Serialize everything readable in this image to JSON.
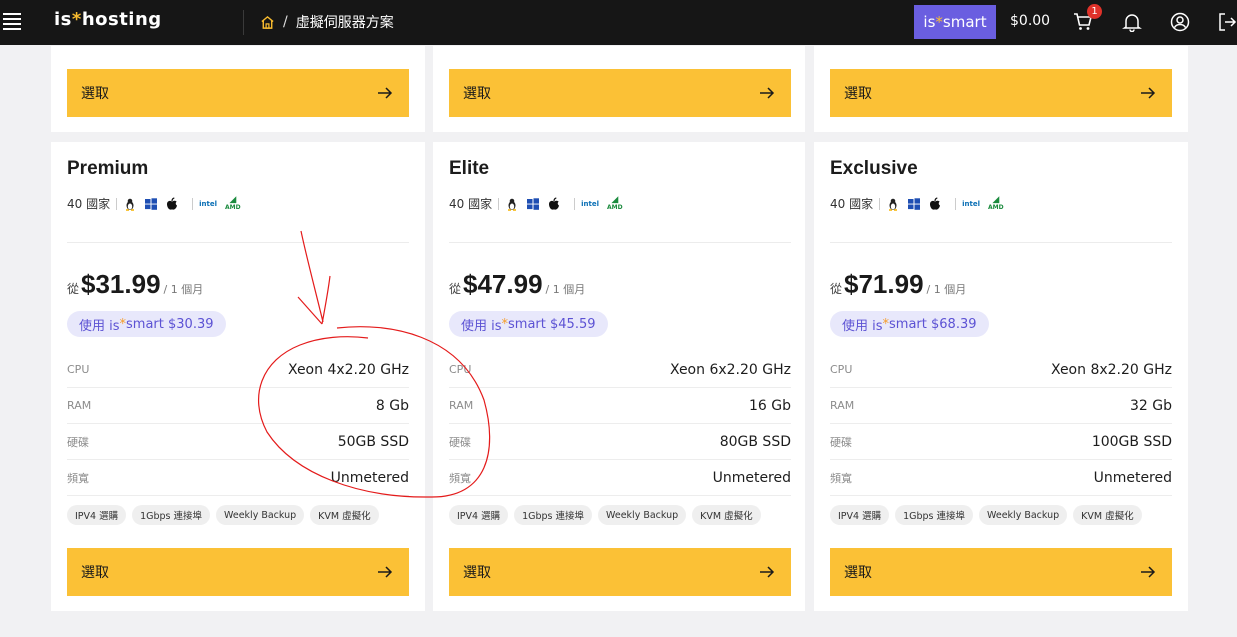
{
  "header": {
    "logo_prefix": "is",
    "logo_star": "*",
    "logo_suffix": "hosting",
    "breadcrumb_sep": "/",
    "breadcrumb_current": "虛擬伺服器方案",
    "smart_prefix": "is",
    "smart_star": "*",
    "smart_suffix": "smart",
    "balance": "$0.00",
    "cart_count": "1",
    "icons": [
      "menu-icon",
      "home-icon",
      "cart-icon",
      "bell-icon",
      "user-icon",
      "logout-icon"
    ]
  },
  "select_label": "選取",
  "top_row_cards": 3,
  "plans": [
    {
      "name": "Premium",
      "countries": "40 國家",
      "intel_label": "intel",
      "amd_label": "AMD",
      "from": "從",
      "price": "$31.99",
      "period": "/ 1 個月",
      "smart_text_prefix": "使用 is",
      "smart_text_star": "*",
      "smart_text_suffix": "smart $30.39",
      "specs": [
        {
          "key": "CPU",
          "value": "Xeon 4x2.20 GHz"
        },
        {
          "key": "RAM",
          "value": "8 Gb"
        },
        {
          "key": "硬碟",
          "value": "50GB SSD"
        },
        {
          "key": "頻寬",
          "value": "Unmetered"
        }
      ],
      "tags": [
        "IPV4 選購",
        "1Gbps 連接埠",
        "Weekly Backup",
        "KVM 虛擬化"
      ]
    },
    {
      "name": "Elite",
      "countries": "40 國家",
      "intel_label": "intel",
      "amd_label": "AMD",
      "from": "從",
      "price": "$47.99",
      "period": "/ 1 個月",
      "smart_text_prefix": "使用 is",
      "smart_text_star": "*",
      "smart_text_suffix": "smart $45.59",
      "specs": [
        {
          "key": "CPU",
          "value": "Xeon 6x2.20 GHz"
        },
        {
          "key": "RAM",
          "value": "16 Gb"
        },
        {
          "key": "硬碟",
          "value": "80GB SSD"
        },
        {
          "key": "頻寬",
          "value": "Unmetered"
        }
      ],
      "tags": [
        "IPV4 選購",
        "1Gbps 連接埠",
        "Weekly Backup",
        "KVM 虛擬化"
      ]
    },
    {
      "name": "Exclusive",
      "countries": "40 國家",
      "intel_label": "intel",
      "amd_label": "AMD",
      "from": "從",
      "price": "$71.99",
      "period": "/ 1 個月",
      "smart_text_prefix": "使用 is",
      "smart_text_star": "*",
      "smart_text_suffix": "smart $68.39",
      "specs": [
        {
          "key": "CPU",
          "value": "Xeon 8x2.20 GHz"
        },
        {
          "key": "RAM",
          "value": "32 Gb"
        },
        {
          "key": "硬碟",
          "value": "100GB SSD"
        },
        {
          "key": "頻寬",
          "value": "Unmetered"
        }
      ],
      "tags": [
        "IPV4 選購",
        "1Gbps 連接埠",
        "Weekly Backup",
        "KVM 虛擬化"
      ]
    }
  ],
  "colors": {
    "topbar": "#161616",
    "accent_yellow": "#fbc136",
    "smart_purple": "#6a5ee0",
    "annotation_red": "#e41b1b"
  }
}
